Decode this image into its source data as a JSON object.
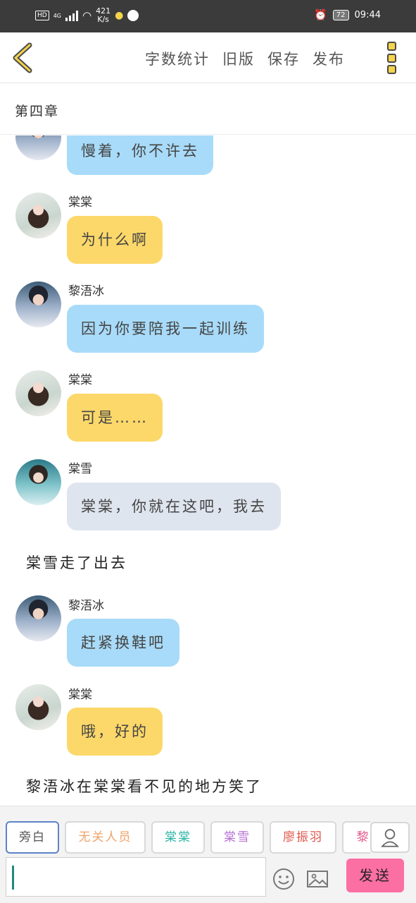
{
  "status_bar": {
    "hd": "HD",
    "network": "4G",
    "speed_value": "421",
    "speed_unit": "K/s",
    "battery": "72",
    "time": "09:44"
  },
  "toolbar": {
    "back_icon": "chevron-left-icon",
    "actions": [
      "字数统计",
      "旧版",
      "保存",
      "发布"
    ],
    "more_icon": "more-vertical-icon"
  },
  "chapter": {
    "title": "第四章"
  },
  "messages": [
    {
      "type": "bubble",
      "speaker": "",
      "text": "慢着，你不许去",
      "color": "#a8dbf9"
    },
    {
      "type": "bubble",
      "speaker": "棠棠",
      "text": "为什么啊",
      "color": "#fcd86a"
    },
    {
      "type": "bubble",
      "speaker": "黎浯冰",
      "text": "因为你要陪我一起训练",
      "color": "#a8dbf9"
    },
    {
      "type": "bubble",
      "speaker": "棠棠",
      "text": "可是……",
      "color": "#fcd86a"
    },
    {
      "type": "bubble",
      "speaker": "棠雪",
      "text": "棠棠，你就在这吧，我去",
      "color": "#dfe5ee"
    },
    {
      "type": "narration",
      "text": "棠雪走了出去"
    },
    {
      "type": "bubble",
      "speaker": "黎浯冰",
      "text": "赶紧换鞋吧",
      "color": "#a8dbf9"
    },
    {
      "type": "bubble",
      "speaker": "棠棠",
      "text": "哦，好的",
      "color": "#fcd86a"
    },
    {
      "type": "narration",
      "text": "黎浯冰在棠棠看不见的地方笑了"
    }
  ],
  "roles": [
    {
      "label": "旁白",
      "color": "#555555",
      "selected": true
    },
    {
      "label": "无关人员",
      "color": "#f0a36a",
      "selected": false
    },
    {
      "label": "棠棠",
      "color": "#2bb5a5",
      "selected": false
    },
    {
      "label": "棠雪",
      "color": "#b76fd3",
      "selected": false
    },
    {
      "label": "廖振羽",
      "color": "#e0564b",
      "selected": false
    },
    {
      "label": "黎",
      "color": "#e05a8a",
      "selected": false
    }
  ],
  "composer": {
    "placeholder": "",
    "emoji_icon": "emoji-icon",
    "image_icon": "image-icon",
    "user_icon": "user-icon",
    "send_label": "发送",
    "send_color": "#fb6fa3"
  }
}
